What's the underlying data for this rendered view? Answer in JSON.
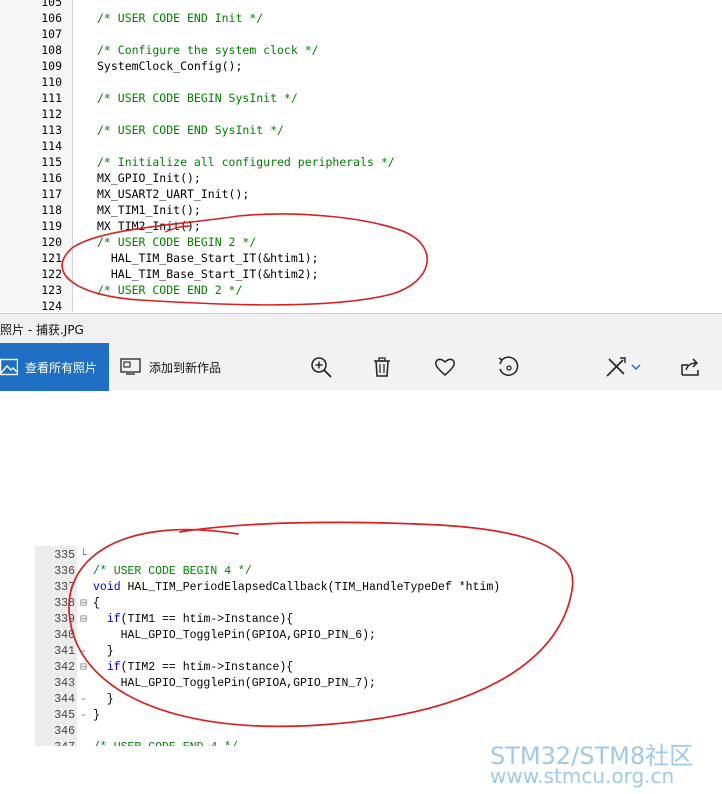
{
  "top_editor": {
    "lines": [
      {
        "n": "105",
        "code": "",
        "comment": false
      },
      {
        "n": "106",
        "code": "/* USER CODE END Init */",
        "comment": true
      },
      {
        "n": "107",
        "code": "",
        "comment": false
      },
      {
        "n": "108",
        "code": "/* Configure the system clock */",
        "comment": true
      },
      {
        "n": "109",
        "code": "SystemClock_Config();",
        "comment": false
      },
      {
        "n": "110",
        "code": "",
        "comment": false
      },
      {
        "n": "111",
        "code": "/* USER CODE BEGIN SysInit */",
        "comment": true
      },
      {
        "n": "112",
        "code": "",
        "comment": false
      },
      {
        "n": "113",
        "code": "/* USER CODE END SysInit */",
        "comment": true
      },
      {
        "n": "114",
        "code": "",
        "comment": false
      },
      {
        "n": "115",
        "code": "/* Initialize all configured peripherals */",
        "comment": true
      },
      {
        "n": "116",
        "code": "MX_GPIO_Init();",
        "comment": false
      },
      {
        "n": "117",
        "code": "MX_USART2_UART_Init();",
        "comment": false
      },
      {
        "n": "118",
        "code": "MX_TIM1_Init();",
        "comment": false
      },
      {
        "n": "119",
        "code": "MX_TIM2_Init();",
        "comment": false
      },
      {
        "n": "120",
        "code": "/* USER CODE BEGIN 2 */",
        "comment": true
      },
      {
        "n": "121",
        "code": "  HAL_TIM_Base_Start_IT(&htim1);",
        "comment": false
      },
      {
        "n": "122",
        "code": "  HAL_TIM_Base_Start_IT(&htim2);",
        "comment": false
      },
      {
        "n": "123",
        "code": "/* USER CODE END 2 */",
        "comment": true
      },
      {
        "n": "124",
        "code": "",
        "comment": false
      }
    ]
  },
  "viewer": {
    "title": "照片 - 捕获.JPG",
    "view_all_label": "查看所有照片",
    "add_to_creation_label": "添加到新作品",
    "icons": [
      "zoom-in-icon",
      "delete-icon",
      "favorite-icon",
      "rotate-icon",
      "edit-icon",
      "share-icon"
    ]
  },
  "bottom_editor": {
    "lines": [
      {
        "n": "335",
        "fold": "└",
        "code": ""
      },
      {
        "n": "336",
        "fold": "",
        "code": "/* USER CODE BEGIN 4 */"
      },
      {
        "n": "337",
        "fold": "",
        "code": "void HAL_TIM_PeriodElapsedCallback(TIM_HandleTypeDef *htim)"
      },
      {
        "n": "338",
        "fold": "⊟",
        "code": "{"
      },
      {
        "n": "339",
        "fold": "⊟",
        "code": "  if(TIM1 == htim->Instance){"
      },
      {
        "n": "340",
        "fold": "",
        "code": "    HAL_GPIO_TogglePin(GPIOA,GPIO_PIN_6);"
      },
      {
        "n": "341",
        "fold": "-",
        "code": "  }"
      },
      {
        "n": "342",
        "fold": "⊟",
        "code": "  if(TIM2 == htim->Instance){"
      },
      {
        "n": "343",
        "fold": "",
        "code": "    HAL_GPIO_TogglePin(GPIOA,GPIO_PIN_7);"
      },
      {
        "n": "344",
        "fold": "-",
        "code": "  }"
      },
      {
        "n": "345",
        "fold": "-",
        "code": "}"
      },
      {
        "n": "346",
        "fold": "",
        "code": ""
      },
      {
        "n": "347",
        "fold": "",
        "code": "/* USER CODE END 4 */"
      }
    ]
  },
  "watermark": {
    "line1": "STM32/STM8社区",
    "line2": "www.stmcu.org.cn"
  },
  "colors": {
    "comment": "#008000",
    "keyword": "#0000ff",
    "accent_blue": "#1f6fc5",
    "ink_red": "#d92020",
    "watermark": "#9fc9e8"
  }
}
